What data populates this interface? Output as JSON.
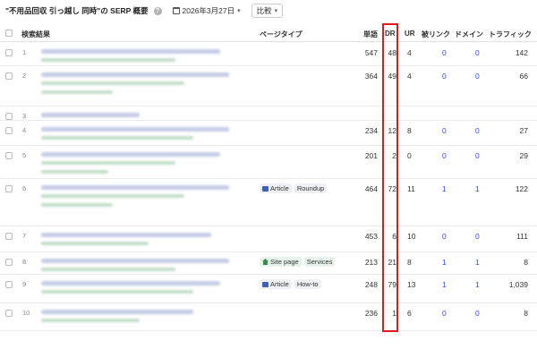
{
  "header": {
    "title": "\"不用品回収 引っ越し 同時\"の SERP 概要",
    "help_icon": "question-circle-icon",
    "date": "2026年3月27日",
    "compare_label": "比較"
  },
  "columns": {
    "results": "検索結果",
    "page_type": "ページタイプ",
    "words": "単語",
    "dr": "DR",
    "ur": "UR",
    "backlinks": "被リンク",
    "domains": "ドメイン",
    "traffic": "トラフィック"
  },
  "rows": [
    {
      "num": "1",
      "type1": "",
      "type2": "",
      "words": "547",
      "dr": "48",
      "ur": "4",
      "backlinks": "0",
      "domains": "0",
      "traffic": "142"
    },
    {
      "num": "2",
      "type1": "",
      "type2": "",
      "words": "364",
      "dr": "49",
      "ur": "4",
      "backlinks": "0",
      "domains": "0",
      "traffic": "66"
    },
    {
      "num": "3",
      "type1": "",
      "type2": "",
      "words": "",
      "dr": "",
      "ur": "",
      "backlinks": "",
      "domains": "",
      "traffic": ""
    },
    {
      "num": "4",
      "type1": "",
      "type2": "",
      "words": "234",
      "dr": "12",
      "ur": "8",
      "backlinks": "0",
      "domains": "0",
      "traffic": "27"
    },
    {
      "num": "5",
      "type1": "",
      "type2": "",
      "words": "201",
      "dr": "2",
      "ur": "0",
      "backlinks": "0",
      "domains": "0",
      "traffic": "29"
    },
    {
      "num": "6",
      "type1": "Article",
      "type2": "Roundup",
      "words": "464",
      "dr": "72",
      "ur": "11",
      "backlinks": "1",
      "domains": "1",
      "traffic": "122"
    },
    {
      "num": "7",
      "type1": "",
      "type2": "",
      "words": "453",
      "dr": "6",
      "ur": "10",
      "backlinks": "0",
      "domains": "0",
      "traffic": "111"
    },
    {
      "num": "8",
      "type1": "Site page",
      "type2": "Services",
      "words": "213",
      "dr": "21",
      "ur": "8",
      "backlinks": "1",
      "domains": "1",
      "traffic": "8"
    },
    {
      "num": "9",
      "type1": "Article",
      "type2": "How-to",
      "words": "248",
      "dr": "79",
      "ur": "13",
      "backlinks": "1",
      "domains": "1",
      "traffic": "1,039"
    },
    {
      "num": "10",
      "type1": "",
      "type2": "",
      "words": "236",
      "dr": "1",
      "ur": "6",
      "backlinks": "0",
      "domains": "0",
      "traffic": "8"
    }
  ],
  "colors": {
    "highlight_border": "#e01919",
    "link_blue": "#2b4fd6"
  }
}
